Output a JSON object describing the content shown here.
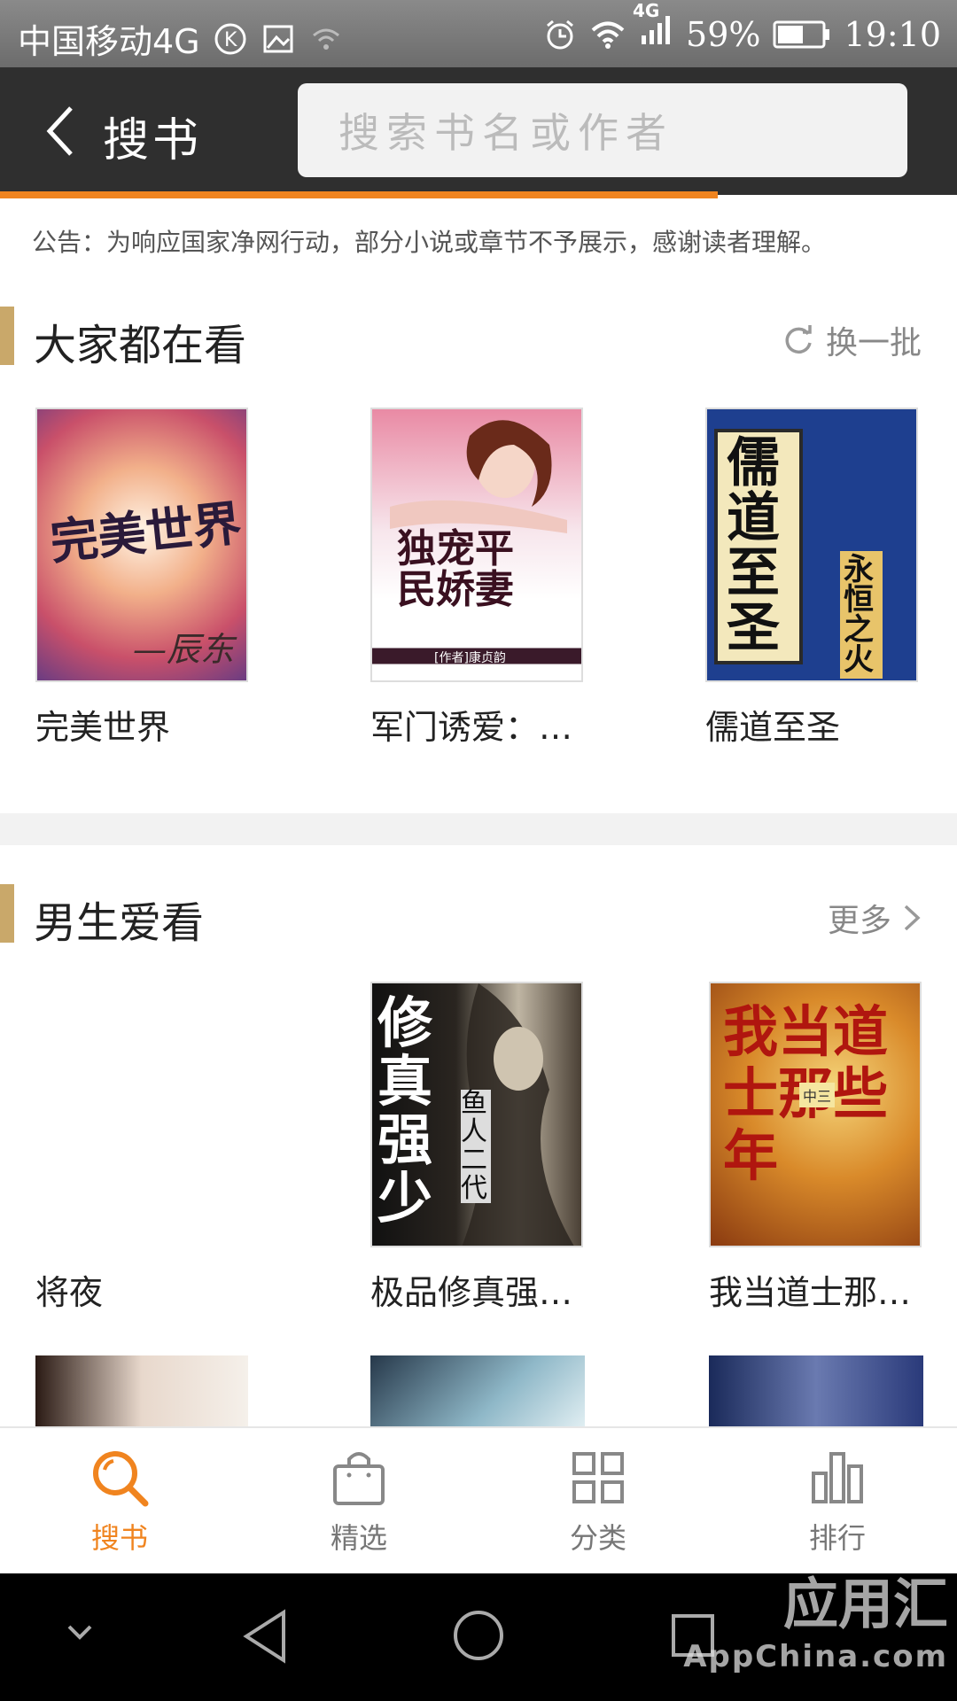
{
  "status": {
    "carrier": "中国移动4G",
    "network": "4G",
    "battery": "59%",
    "time": "19:10"
  },
  "header": {
    "title": "搜书",
    "search_placeholder": "搜索书名或作者"
  },
  "notice": "公告：为响应国家净网行动，部分小说或章节不予展示，感谢读者理解。",
  "popular": {
    "title": "大家都在看",
    "action": "换一批",
    "books": [
      {
        "title": "完美世界",
        "cover_text": "完美世界",
        "cover_sub": "—辰东"
      },
      {
        "title": "军门诱爱：…",
        "cover_text": "独宠平民娇妻",
        "cover_sub": "[作者]康贞韵"
      },
      {
        "title": "儒道至圣",
        "cover_text": "儒道至圣",
        "cover_sub": "永恒之火"
      }
    ]
  },
  "male": {
    "title": "男生爱看",
    "action": "更多",
    "books": [
      {
        "title": "将夜",
        "cover_text": ""
      },
      {
        "title": "极品修真强…",
        "cover_text": "修真强少",
        "cover_sub": "鱼人二代"
      },
      {
        "title": "我当道士那…",
        "cover_text": "我当道士那些年",
        "cover_sub": "中三"
      }
    ]
  },
  "tabs": [
    {
      "label": "搜书",
      "icon": "search-icon",
      "active": true
    },
    {
      "label": "精选",
      "icon": "bag-icon",
      "active": false
    },
    {
      "label": "分类",
      "icon": "grid-icon",
      "active": false
    },
    {
      "label": "排行",
      "icon": "bars-icon",
      "active": false
    }
  ],
  "watermark": {
    "brand": "应用汇",
    "sub": "AppChina.com"
  },
  "colors": {
    "accent": "#f0841f",
    "header": "#2f2f2f",
    "section_bar": "#c9a86a"
  }
}
